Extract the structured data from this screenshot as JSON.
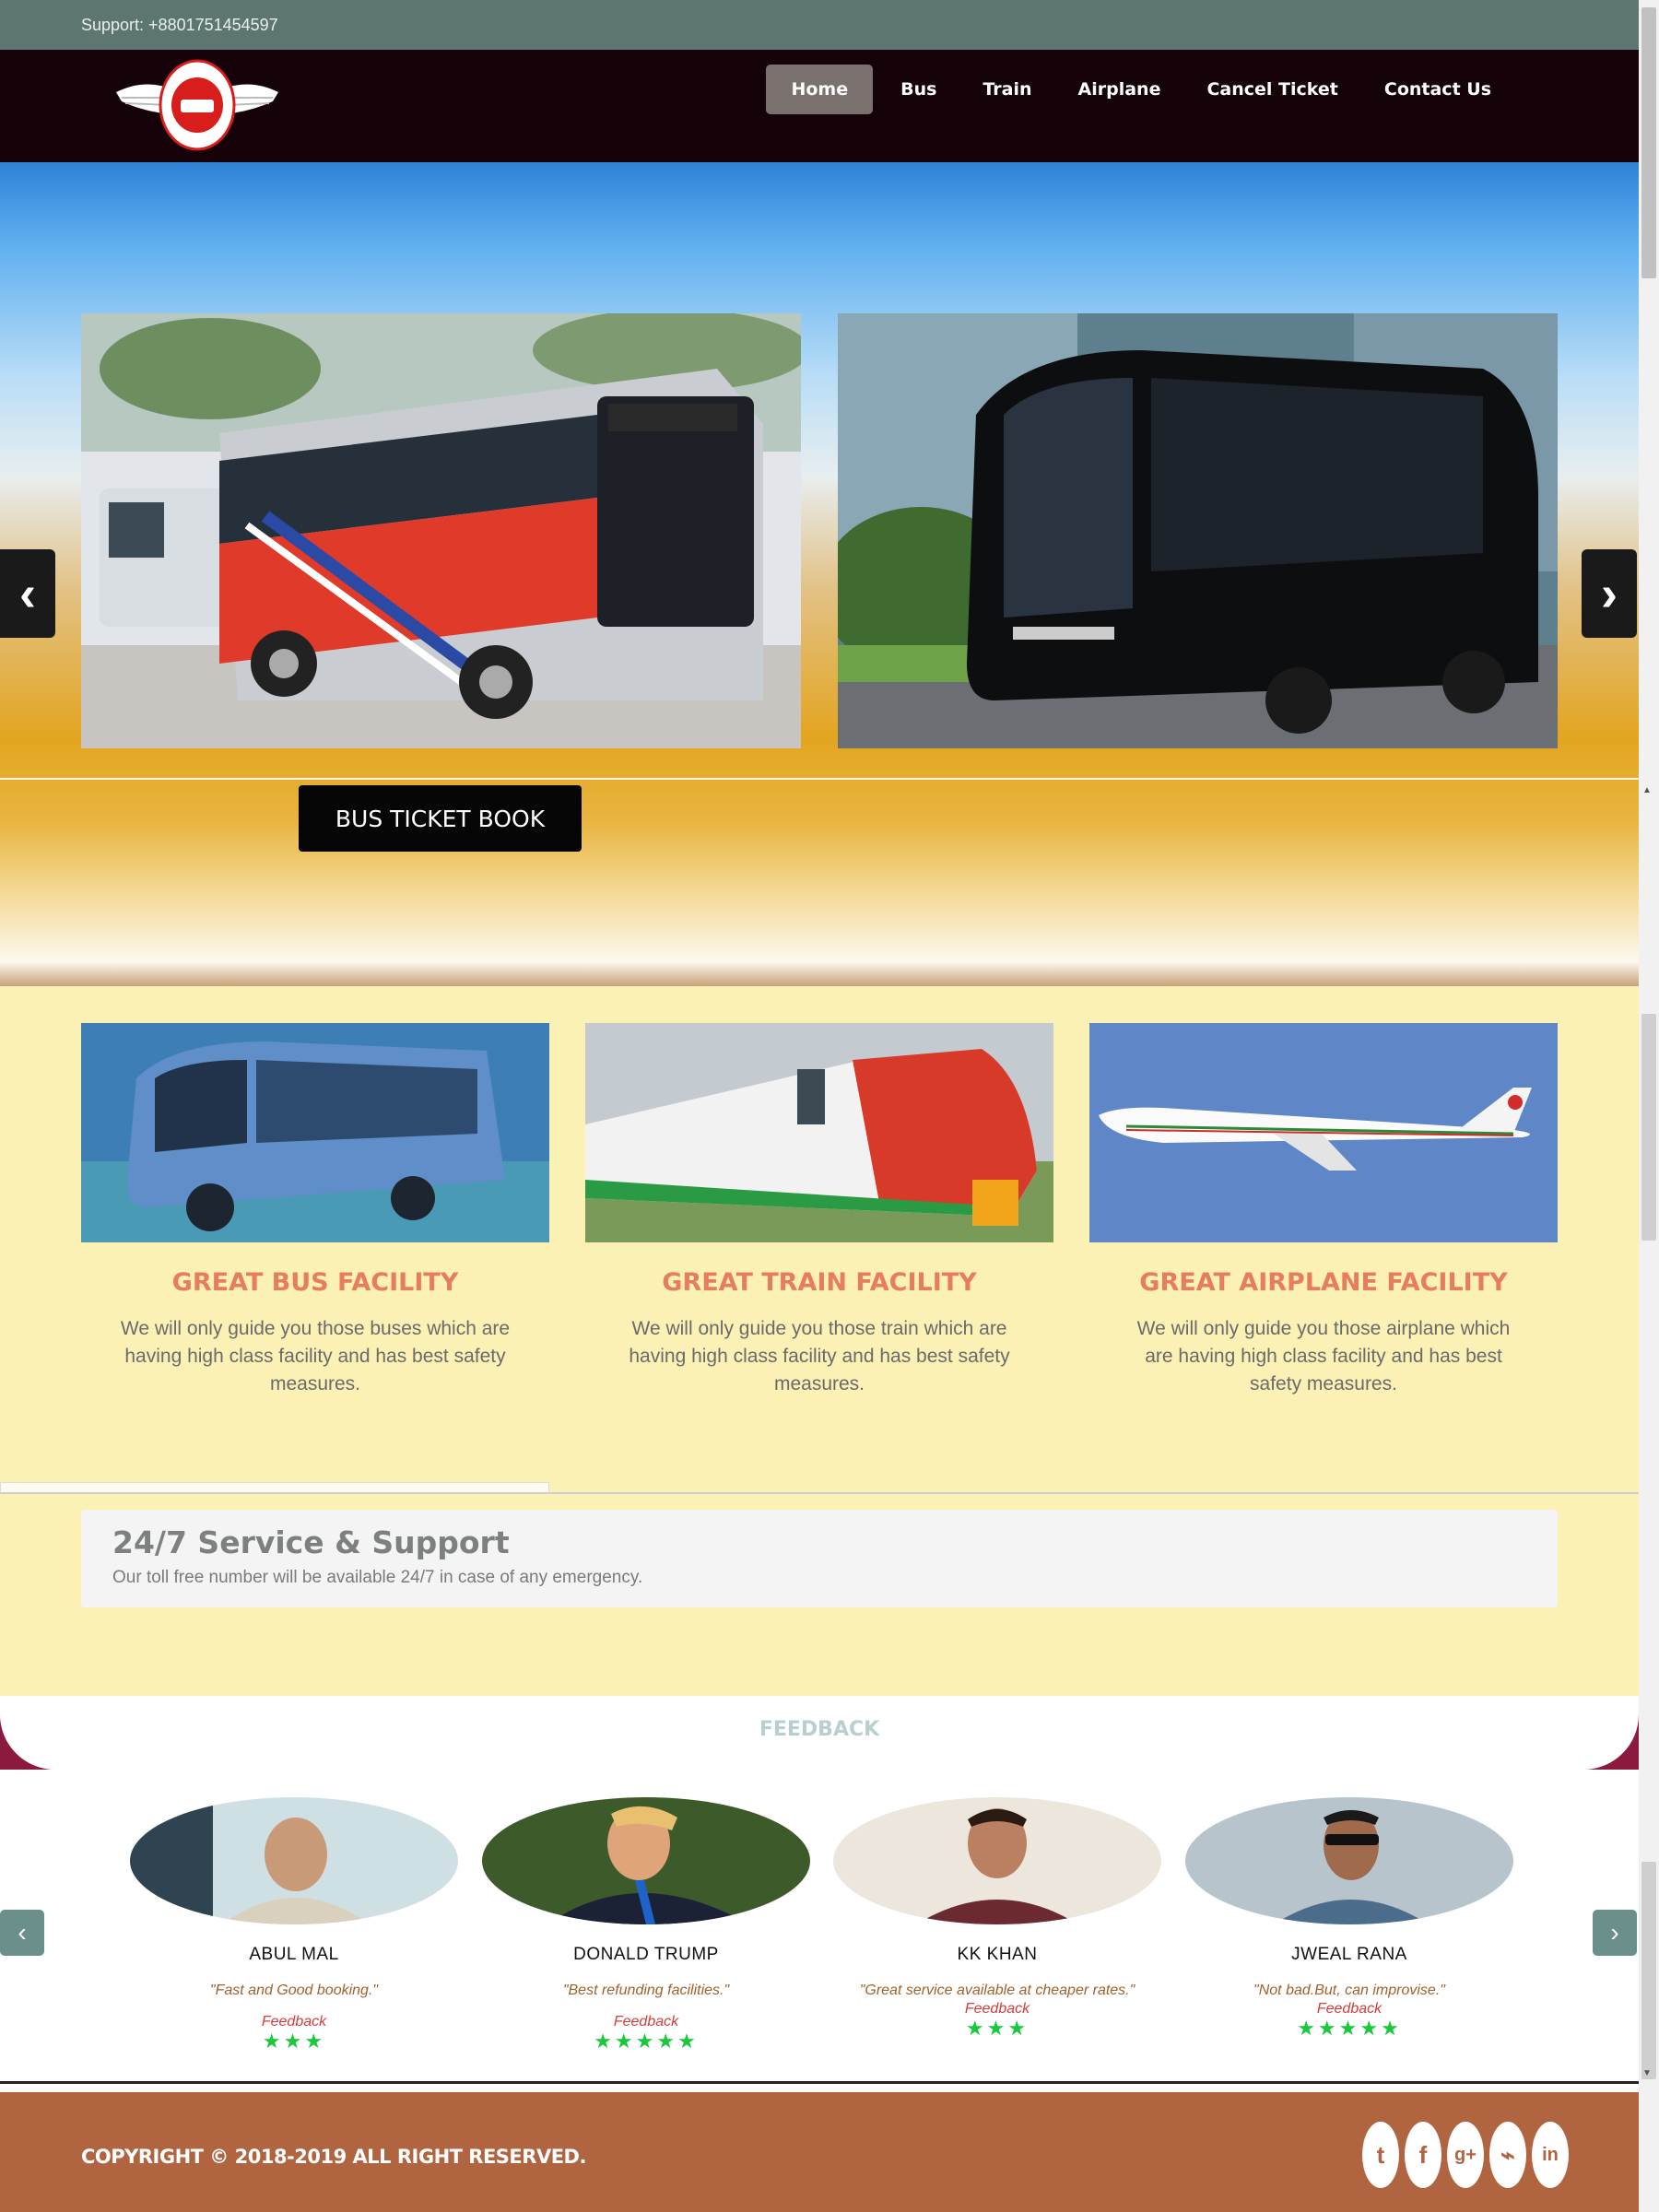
{
  "topbar": {
    "support": "Support: +8801751454597"
  },
  "nav": {
    "items": [
      "Home",
      "Bus",
      "Train",
      "Airplane",
      "Cancel Ticket",
      "Contact Us"
    ],
    "active": "Home"
  },
  "hero": {
    "book_button": "BUS TICKET BOOK",
    "prev_icon": "chevron-left-icon",
    "next_icon": "chevron-right-icon"
  },
  "facilities": [
    {
      "title": "GREAT BUS FACILITY",
      "text": "We will only guide you those buses which are having high class facility and has best safety measures."
    },
    {
      "title": "GREAT TRAIN FACILITY",
      "text": "We will only guide you those train which are having high class facility and has best safety measures."
    },
    {
      "title": "GREAT AIRPLANE FACILITY",
      "text": "We will only guide you those airplane which are having high class facility and has best safety measures."
    }
  ],
  "support": {
    "title": "24/7 Service & Support",
    "text": "Our toll free number will be available 24/7 in case of any emergency."
  },
  "feedback": {
    "title": "FEEDBACK",
    "label": "Feedback",
    "items": [
      {
        "name": "ABUL MAL",
        "quote": "\"Fast and Good booking.\"",
        "stars": "★★★",
        "rating": 3
      },
      {
        "name": "DONALD TRUMP",
        "quote": "\"Best refunding facilities.\"",
        "stars": "★★★★★",
        "rating": 5
      },
      {
        "name": "KK KHAN",
        "quote": "\"Great service available at cheaper rates.\"",
        "stars": "★★★",
        "rating": 3
      },
      {
        "name": "JWEAL RANA",
        "quote": "\"Not bad.But, can improvise.\"",
        "stars": "★★★★★",
        "rating": 5
      }
    ]
  },
  "footer": {
    "copyright": "COPYRIGHT © 2018-2019 ALL RIGHT RESERVED.",
    "socials": [
      "twitter-icon",
      "facebook-icon",
      "google-plus-icon",
      "rss-icon",
      "linkedin-icon"
    ],
    "social_glyphs": [
      "t",
      "f",
      "g+",
      "⌁",
      "in"
    ]
  },
  "colors": {
    "topbar": "#5e7672",
    "navbar": "#160309",
    "facility_bg": "#fbf1b5",
    "facility_title": "#e77d5d",
    "footer": "#b06440",
    "stars": "#19c93b"
  }
}
